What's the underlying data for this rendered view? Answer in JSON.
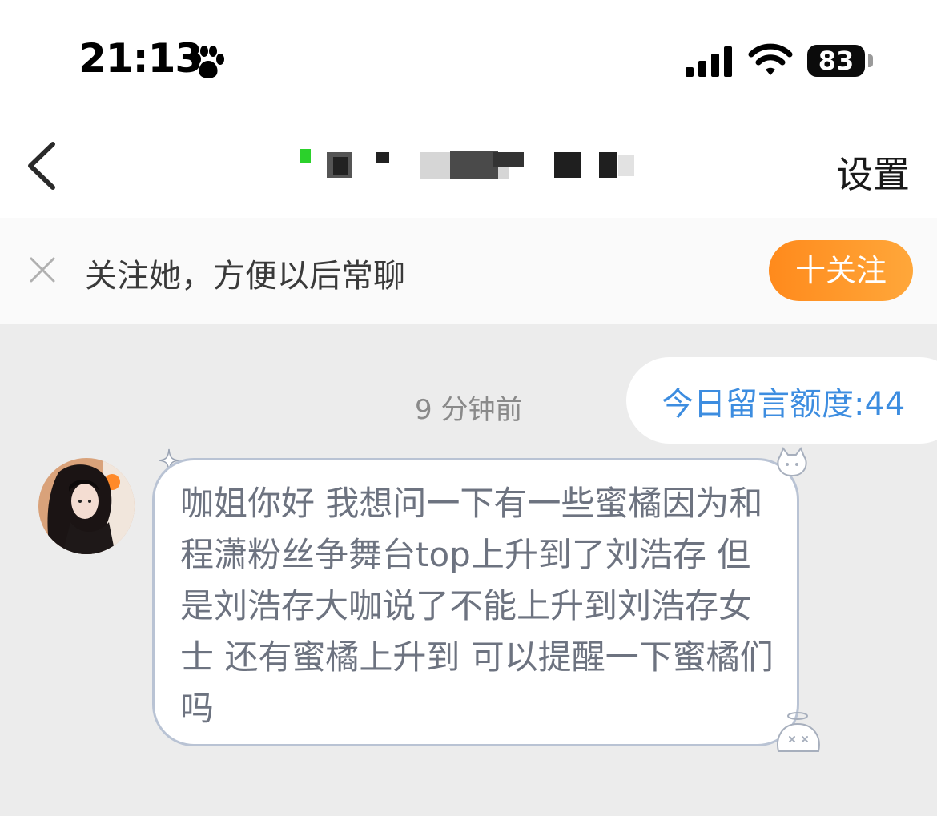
{
  "status_bar": {
    "time": "21:13",
    "battery": "83"
  },
  "nav": {
    "settings_label": "设置"
  },
  "follow_banner": {
    "text": "关注她，方便以后常聊",
    "button_label": "十关注"
  },
  "quota": {
    "label": "今日留言额度:44"
  },
  "messages": [
    {
      "timestamp": "9 分钟前",
      "text": "咖姐你好 我想问一下有一些蜜橘因为和程潇粉丝争舞台top上升到了刘浩存 但是刘浩存大咖说了不能上升到刘浩存女士 还有蜜橘上升到 可以提醒一下蜜橘们吗"
    }
  ],
  "colors": {
    "accent_orange": "#ff8a1c",
    "quota_blue": "#3d8de0",
    "bubble_border": "#b9c3d4"
  }
}
